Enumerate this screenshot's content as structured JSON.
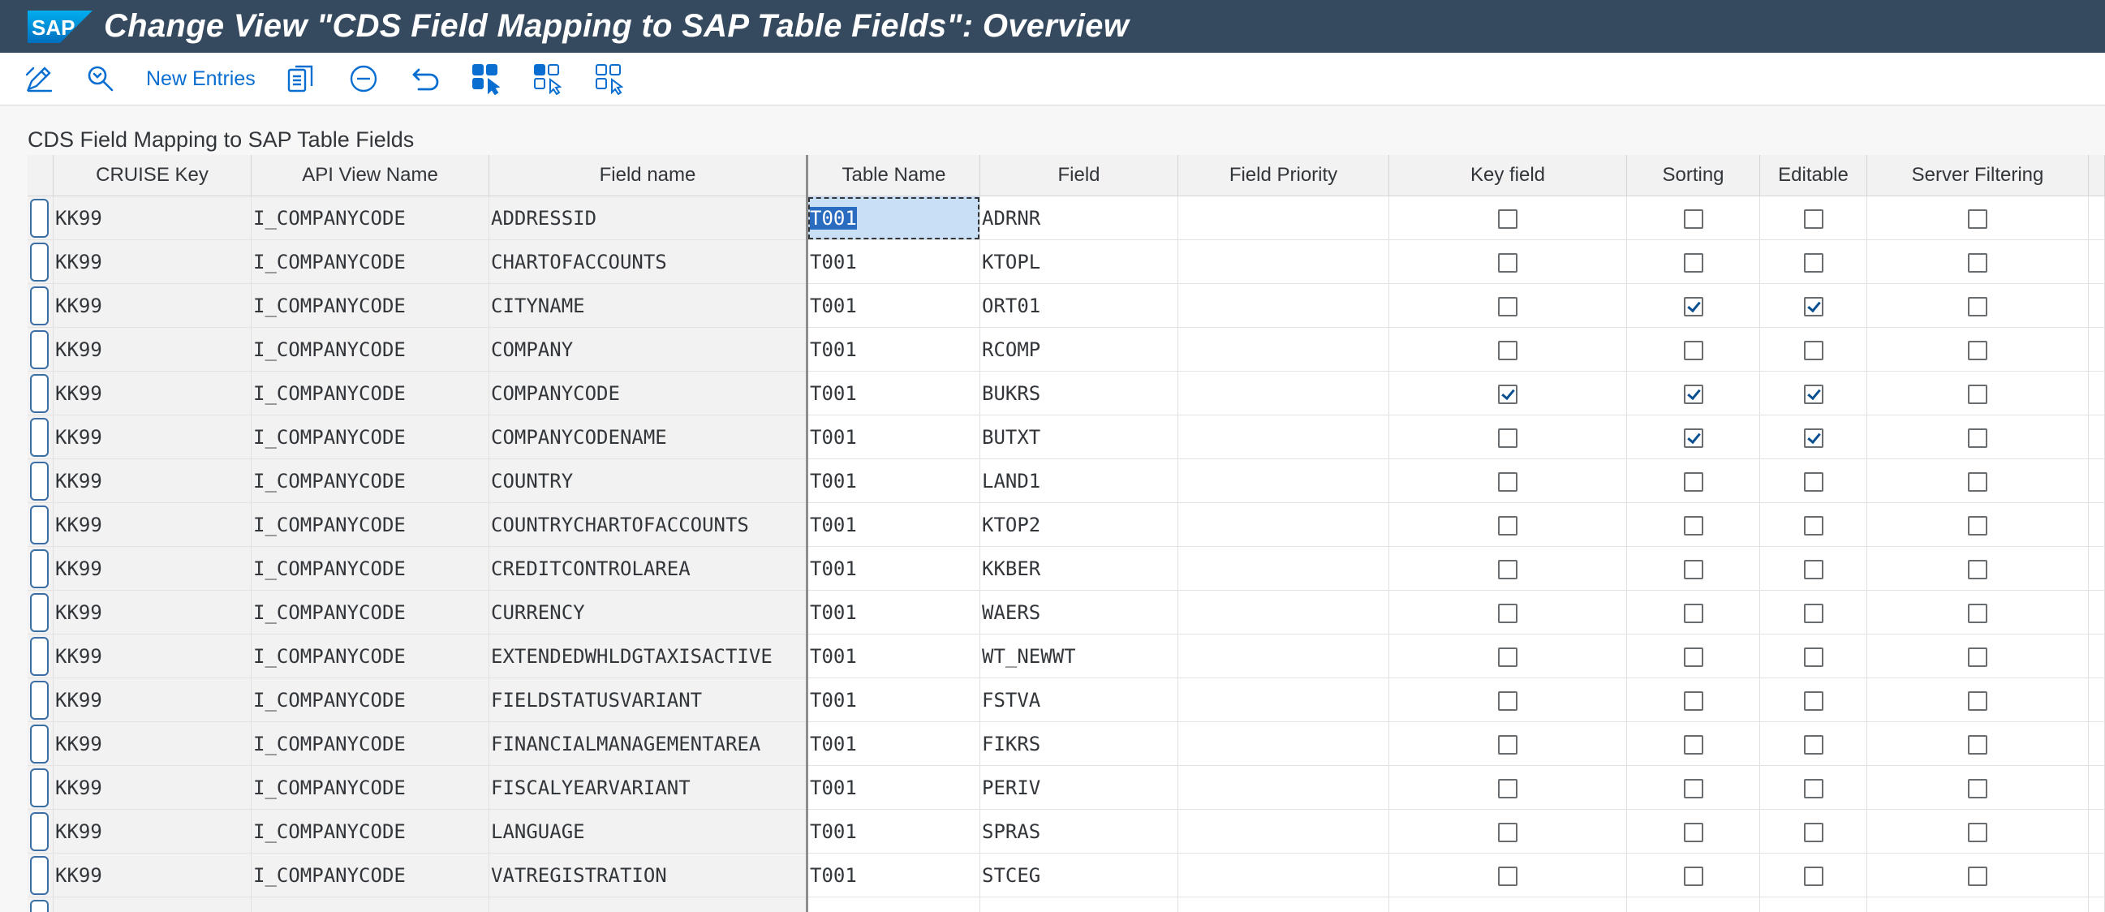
{
  "titlebar": {
    "logo_text": "SAP",
    "title": "Change View \"CDS Field Mapping to SAP Table Fields\": Overview"
  },
  "toolbar": {
    "icons": [
      "display-change-icon",
      "search-icon",
      "copy-icon",
      "delete-icon",
      "undo-icon",
      "select-all-icon",
      "select-block-icon",
      "deselect-all-icon"
    ],
    "new_entries_label": "New Entries"
  },
  "section_title": "CDS Field Mapping to SAP Table Fields",
  "table": {
    "columns": [
      "CRUISE Key",
      "API View Name",
      "Field name",
      "Table Name",
      "Field",
      "Field Priority",
      "Key field",
      "Sorting",
      "Editable",
      "Server Filtering"
    ],
    "rows": [
      {
        "cruise_key": "KK99",
        "api_view": "I_COMPANYCODE",
        "field_name": "ADDRESSID",
        "table_name": "T001",
        "field": "ADRNR",
        "priority": "",
        "key_field": false,
        "sorting": false,
        "editable": false,
        "server_filtering": false
      },
      {
        "cruise_key": "KK99",
        "api_view": "I_COMPANYCODE",
        "field_name": "CHARTOFACCOUNTS",
        "table_name": "T001",
        "field": "KTOPL",
        "priority": "",
        "key_field": false,
        "sorting": false,
        "editable": false,
        "server_filtering": false
      },
      {
        "cruise_key": "KK99",
        "api_view": "I_COMPANYCODE",
        "field_name": "CITYNAME",
        "table_name": "T001",
        "field": "ORT01",
        "priority": "",
        "key_field": false,
        "sorting": true,
        "editable": true,
        "server_filtering": false
      },
      {
        "cruise_key": "KK99",
        "api_view": "I_COMPANYCODE",
        "field_name": "COMPANY",
        "table_name": "T001",
        "field": "RCOMP",
        "priority": "",
        "key_field": false,
        "sorting": false,
        "editable": false,
        "server_filtering": false
      },
      {
        "cruise_key": "KK99",
        "api_view": "I_COMPANYCODE",
        "field_name": "COMPANYCODE",
        "table_name": "T001",
        "field": "BUKRS",
        "priority": "",
        "key_field": true,
        "sorting": true,
        "editable": true,
        "server_filtering": false
      },
      {
        "cruise_key": "KK99",
        "api_view": "I_COMPANYCODE",
        "field_name": "COMPANYCODENAME",
        "table_name": "T001",
        "field": "BUTXT",
        "priority": "",
        "key_field": false,
        "sorting": true,
        "editable": true,
        "server_filtering": false
      },
      {
        "cruise_key": "KK99",
        "api_view": "I_COMPANYCODE",
        "field_name": "COUNTRY",
        "table_name": "T001",
        "field": "LAND1",
        "priority": "",
        "key_field": false,
        "sorting": false,
        "editable": false,
        "server_filtering": false
      },
      {
        "cruise_key": "KK99",
        "api_view": "I_COMPANYCODE",
        "field_name": "COUNTRYCHARTOFACCOUNTS",
        "table_name": "T001",
        "field": "KTOP2",
        "priority": "",
        "key_field": false,
        "sorting": false,
        "editable": false,
        "server_filtering": false
      },
      {
        "cruise_key": "KK99",
        "api_view": "I_COMPANYCODE",
        "field_name": "CREDITCONTROLAREA",
        "table_name": "T001",
        "field": "KKBER",
        "priority": "",
        "key_field": false,
        "sorting": false,
        "editable": false,
        "server_filtering": false
      },
      {
        "cruise_key": "KK99",
        "api_view": "I_COMPANYCODE",
        "field_name": "CURRENCY",
        "table_name": "T001",
        "field": "WAERS",
        "priority": "",
        "key_field": false,
        "sorting": false,
        "editable": false,
        "server_filtering": false
      },
      {
        "cruise_key": "KK99",
        "api_view": "I_COMPANYCODE",
        "field_name": "EXTENDEDWHLDGTAXISACTIVE",
        "table_name": "T001",
        "field": "WT_NEWWT",
        "priority": "",
        "key_field": false,
        "sorting": false,
        "editable": false,
        "server_filtering": false
      },
      {
        "cruise_key": "KK99",
        "api_view": "I_COMPANYCODE",
        "field_name": "FIELDSTATUSVARIANT",
        "table_name": "T001",
        "field": "FSTVA",
        "priority": "",
        "key_field": false,
        "sorting": false,
        "editable": false,
        "server_filtering": false
      },
      {
        "cruise_key": "KK99",
        "api_view": "I_COMPANYCODE",
        "field_name": "FINANCIALMANAGEMENTAREA",
        "table_name": "T001",
        "field": "FIKRS",
        "priority": "",
        "key_field": false,
        "sorting": false,
        "editable": false,
        "server_filtering": false
      },
      {
        "cruise_key": "KK99",
        "api_view": "I_COMPANYCODE",
        "field_name": "FISCALYEARVARIANT",
        "table_name": "T001",
        "field": "PERIV",
        "priority": "",
        "key_field": false,
        "sorting": false,
        "editable": false,
        "server_filtering": false
      },
      {
        "cruise_key": "KK99",
        "api_view": "I_COMPANYCODE",
        "field_name": "LANGUAGE",
        "table_name": "T001",
        "field": "SPRAS",
        "priority": "",
        "key_field": false,
        "sorting": false,
        "editable": false,
        "server_filtering": false
      },
      {
        "cruise_key": "KK99",
        "api_view": "I_COMPANYCODE",
        "field_name": "VATREGISTRATION",
        "table_name": "T001",
        "field": "STCEG",
        "priority": "",
        "key_field": false,
        "sorting": false,
        "editable": false,
        "server_filtering": false
      }
    ]
  },
  "colors": {
    "titlebar_bg": "#354a5f",
    "accent": "#0a6ed1",
    "selection": "#2a6cc0"
  }
}
